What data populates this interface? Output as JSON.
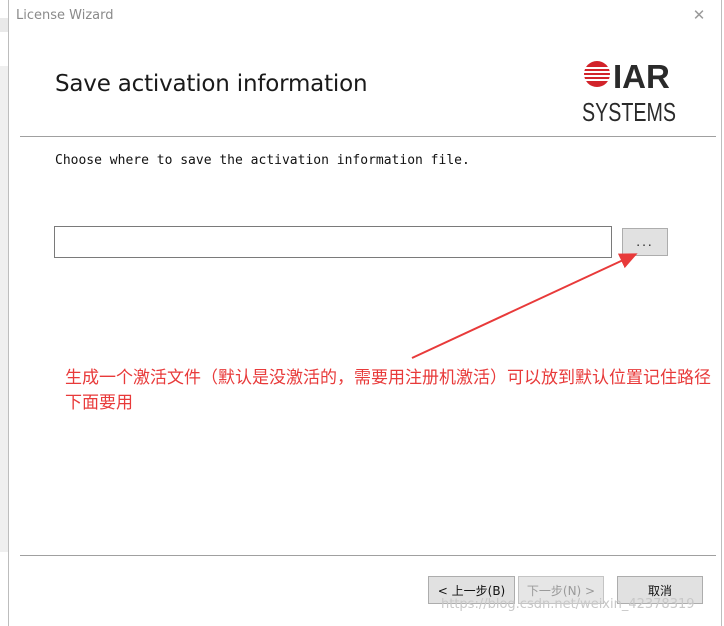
{
  "window": {
    "title": "License Wizard",
    "close_glyph": "✕"
  },
  "header": {
    "heading": "Save activation information",
    "logo": {
      "brand_top": "IAR",
      "brand_bottom": "SYSTEMS",
      "accent_color": "#d2232a"
    }
  },
  "body": {
    "instruction": "Choose where to save the activation information file.",
    "path_input": {
      "value": "",
      "placeholder": ""
    },
    "browse_label": "..."
  },
  "annotation": {
    "text": "生成一个激活文件（默认是没激活的，需要用注册机激活）可以放到默认位置记住路径下面要用",
    "color": "#e83a3a"
  },
  "footer": {
    "back_label": "< 上一步(B)",
    "next_label": "下一步(N) >",
    "cancel_label": "取消"
  },
  "watermark": {
    "text": "https://blog.csdn.net/weixin_42378319"
  }
}
